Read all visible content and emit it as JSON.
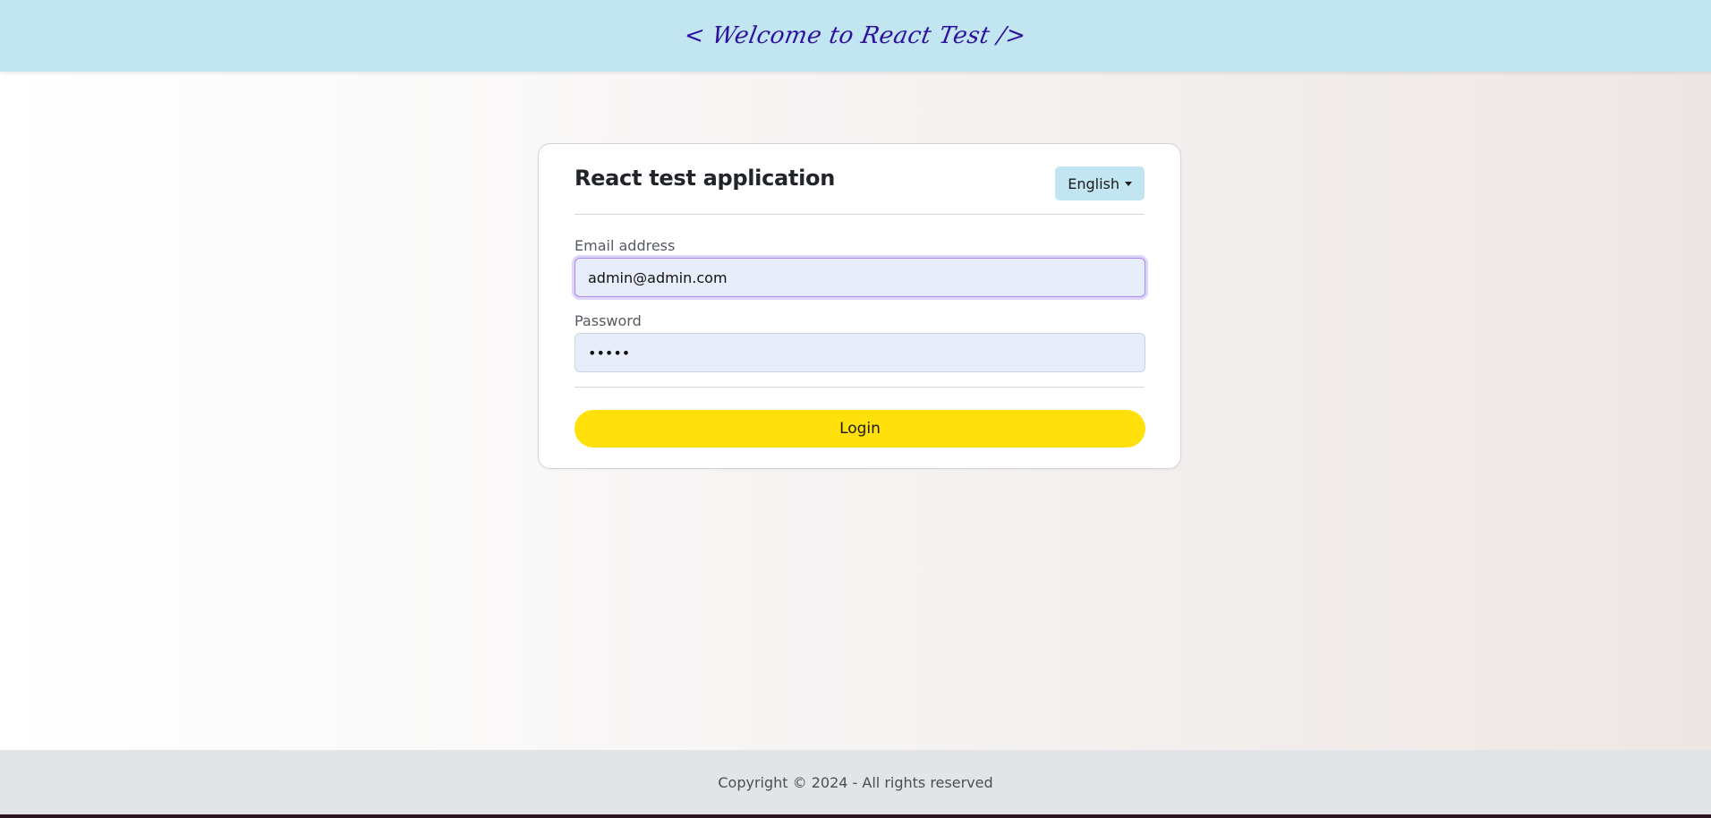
{
  "header": {
    "title": "< Welcome to React Test />"
  },
  "card": {
    "title": "React test application",
    "language": {
      "selected": "English"
    },
    "email": {
      "label": "Email address",
      "value": "admin@admin.com"
    },
    "password": {
      "label": "Password",
      "value": "•••••"
    },
    "login_label": "Login"
  },
  "footer": {
    "text": "Copyright © 2024 - All rights reserved"
  },
  "colors": {
    "header_bg": "#c1e5f1",
    "header_text": "#2e0f9e",
    "login_button": "#ffe00b",
    "input_bg": "#e8edfc",
    "footer_bg": "#e3e4e8"
  }
}
